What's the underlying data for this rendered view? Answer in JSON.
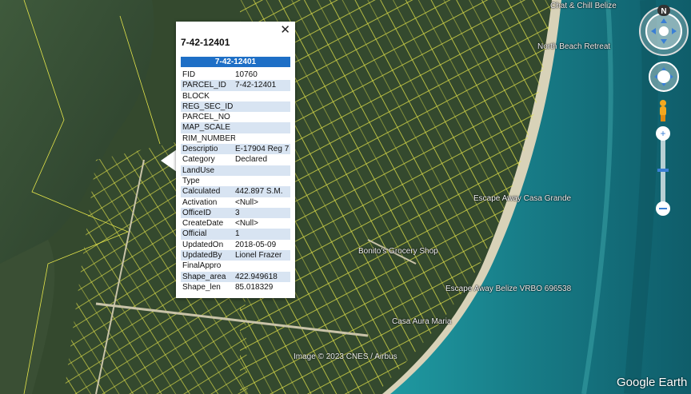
{
  "popup": {
    "title": "7-42-12401",
    "header": "7-42-12401",
    "close_glyph": "✕",
    "fields": [
      {
        "k": "FID",
        "v": "10760"
      },
      {
        "k": "PARCEL_ID",
        "v": "7-42-12401"
      },
      {
        "k": "BLOCK",
        "v": ""
      },
      {
        "k": "REG_SEC_ID",
        "v": ""
      },
      {
        "k": "PARCEL_NO",
        "v": ""
      },
      {
        "k": "MAP_SCALE",
        "v": ""
      },
      {
        "k": "RIM_NUMBER",
        "v": ""
      },
      {
        "k": "Descriptio",
        "v": "E-17904 Reg 7"
      },
      {
        "k": "Category",
        "v": "Declared"
      },
      {
        "k": "LandUse",
        "v": ""
      },
      {
        "k": "Type",
        "v": ""
      },
      {
        "k": "Calculated",
        "v": "442.897 S.M."
      },
      {
        "k": "Activation",
        "v": "<Null>"
      },
      {
        "k": "OfficeID",
        "v": "3"
      },
      {
        "k": "CreateDate",
        "v": "<Null>"
      },
      {
        "k": "Official",
        "v": "1"
      },
      {
        "k": "UpdatedOn",
        "v": "2018-05-09"
      },
      {
        "k": "UpdatedBy",
        "v": "Lionel Frazer"
      },
      {
        "k": "FinalAppro",
        "v": ""
      },
      {
        "k": "Shape_area",
        "v": "422.949618"
      },
      {
        "k": "Shape_len",
        "v": "85.018329"
      }
    ]
  },
  "places": {
    "chill": "Chat & Chill Belize",
    "north_beach": "North Beach Retreat",
    "casa_grande": "Escape Away Casa Grande",
    "bonito": "Bonito's Grocery Shop",
    "vrbo": "Escape Away Belize VRBO 696538",
    "aura": "Casa Aura Maria"
  },
  "credit": "Image © 2023 CNES / Airbus",
  "brand": "Google Earth",
  "compass_label": "N",
  "colors": {
    "parcel_lines": "#e8e84a",
    "water": "#1c8a8a",
    "vegetation": "#2f4a2c"
  }
}
